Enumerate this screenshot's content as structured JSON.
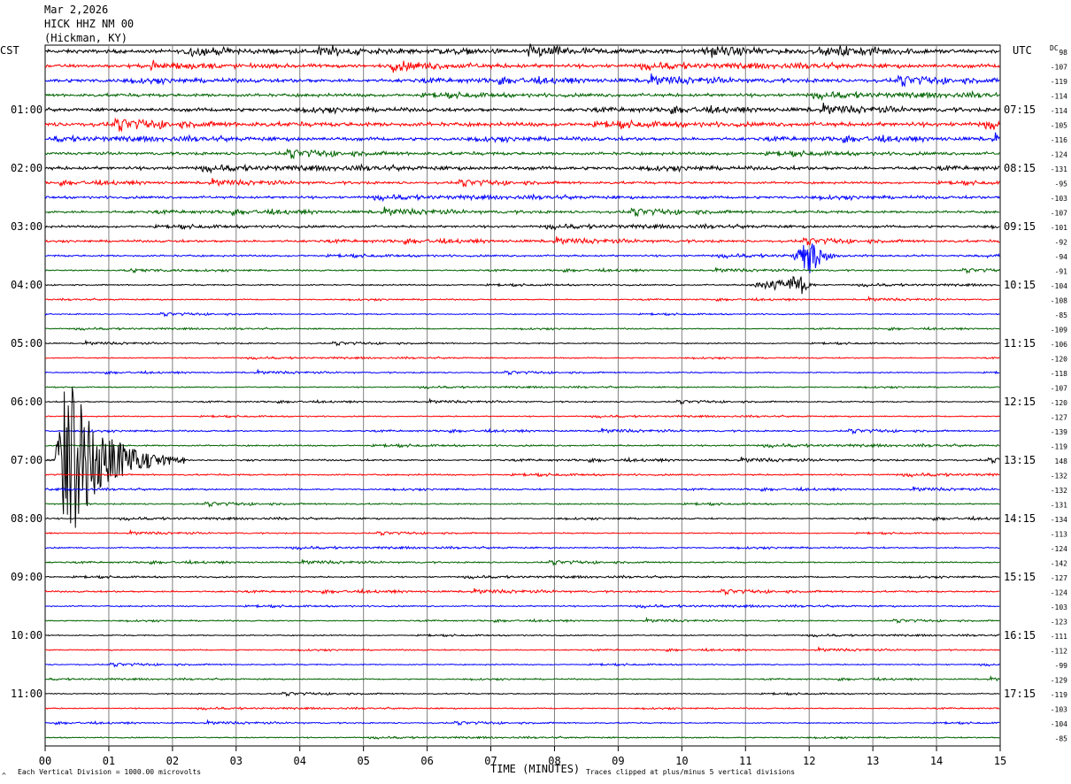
{
  "header": {
    "date": "Mar 2,2026",
    "station": "HICK HHZ NM 00",
    "location": "(Hickman, KY)"
  },
  "axis": {
    "left_zone": "CST",
    "right_zone": "UTC",
    "dc_label": "DC",
    "xlabel": "TIME (MINUTES)"
  },
  "footer": {
    "left_note": "Each Vertical Division = 1000.00 microvolts",
    "right_note": "Traces clipped at plus/minus 5 vertical divisions",
    "corner_mark": "^"
  },
  "colors": {
    "trace_cycle": [
      "#000000",
      "#ff0000",
      "#0000ff",
      "#006400"
    ],
    "grid": "#808080"
  },
  "chart_data": {
    "type": "line",
    "title": "HICK HHZ NM 00",
    "xlabel": "TIME (MINUTES)",
    "xlim": [
      0,
      15
    ],
    "x_ticks": [
      "00",
      "01",
      "02",
      "03",
      "04",
      "05",
      "06",
      "07",
      "08",
      "09",
      "10",
      "11",
      "12",
      "13",
      "14",
      "15"
    ],
    "rows": 48,
    "minutes_per_row": 15,
    "cst_labels": [
      {
        "row": 4,
        "label": "01:00"
      },
      {
        "row": 8,
        "label": "02:00"
      },
      {
        "row": 12,
        "label": "03:00"
      },
      {
        "row": 16,
        "label": "04:00"
      },
      {
        "row": 20,
        "label": "05:00"
      },
      {
        "row": 24,
        "label": "06:00"
      },
      {
        "row": 28,
        "label": "07:00"
      },
      {
        "row": 32,
        "label": "08:00"
      },
      {
        "row": 36,
        "label": "09:00"
      },
      {
        "row": 40,
        "label": "10:00"
      },
      {
        "row": 44,
        "label": "11:00"
      }
    ],
    "utc_labels": [
      {
        "row": 4,
        "label": "07:15"
      },
      {
        "row": 8,
        "label": "08:15"
      },
      {
        "row": 12,
        "label": "09:15"
      },
      {
        "row": 16,
        "label": "10:15"
      },
      {
        "row": 20,
        "label": "11:15"
      },
      {
        "row": 24,
        "label": "12:15"
      },
      {
        "row": 28,
        "label": "13:15"
      },
      {
        "row": 32,
        "label": "14:15"
      },
      {
        "row": 36,
        "label": "15:15"
      },
      {
        "row": 40,
        "label": "16:15"
      },
      {
        "row": 44,
        "label": "17:15"
      }
    ],
    "dc_offsets": [
      "98",
      "-107",
      "-119",
      "-114",
      "-114",
      "-105",
      "-116",
      "-124",
      "-131",
      "-95",
      "-103",
      "-107",
      "-101",
      "-92",
      "-94",
      "-91",
      "-104",
      "-108",
      "-85",
      "-109",
      "-106",
      "-120",
      "-118",
      "-107",
      "-120",
      "-127",
      "-139",
      "-119",
      "148",
      "-132",
      "-132",
      "-131",
      "-134",
      "-113",
      "-124",
      "-142",
      "-127",
      "-124",
      "-103",
      "-123",
      "-111",
      "-112",
      "-99",
      "-129",
      "-119",
      "-103",
      "-104",
      "-85"
    ],
    "noise_level": [
      1.6,
      1.5,
      1.5,
      1.4,
      1.5,
      1.8,
      1.4,
      1.3,
      1.4,
      1.0,
      1.1,
      1.1,
      1.0,
      1.0,
      0.8,
      0.6,
      0.6,
      0.5,
      0.5,
      0.5,
      0.5,
      0.5,
      0.5,
      0.5,
      0.5,
      0.5,
      0.6,
      0.7,
      0.7,
      0.7,
      0.6,
      0.6,
      0.6,
      0.5,
      0.6,
      0.6,
      0.6,
      0.7,
      0.6,
      0.5,
      0.5,
      0.5,
      0.5,
      0.5,
      0.5,
      0.5,
      0.5,
      0.5
    ],
    "events": [
      {
        "row": 28,
        "start_min": 0.15,
        "peak_min": 0.3,
        "end_min": 2.2,
        "amplitude_div": 5,
        "clipped": true,
        "label": "large earthquake"
      },
      {
        "row": 14,
        "start_min": 11.7,
        "peak_min": 12.05,
        "end_min": 12.5,
        "amplitude_div": 1.1,
        "clipped": false,
        "label": "local event"
      },
      {
        "row": 16,
        "start_min": 11.0,
        "peak_min": 11.9,
        "end_min": 12.2,
        "amplitude_div": 0.5,
        "clipped": false,
        "label": "local event"
      }
    ]
  }
}
